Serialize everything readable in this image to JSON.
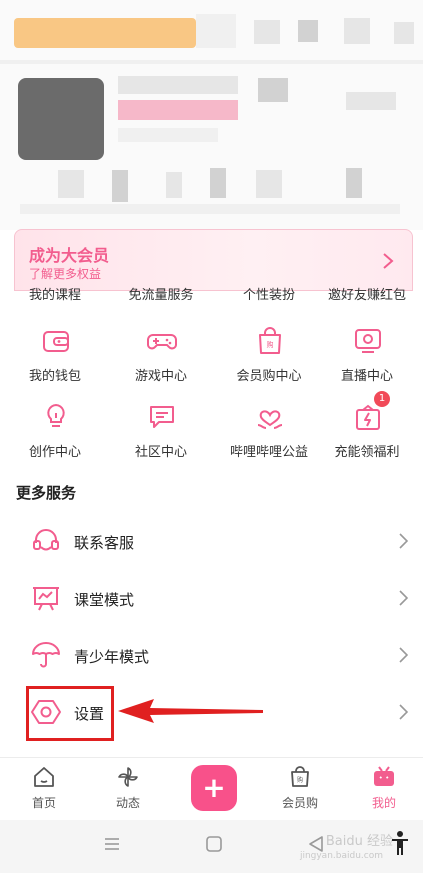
{
  "vip": {
    "title": "成为大会员",
    "subtitle": "了解更多权益"
  },
  "grid_partial_labels": [
    "我的课程",
    "免流量服务",
    "个性装扮",
    "邀好友赚红包"
  ],
  "grid": [
    {
      "label": "我的钱包",
      "icon": "wallet-icon"
    },
    {
      "label": "游戏中心",
      "icon": "gamepad-icon"
    },
    {
      "label": "会员购中心",
      "icon": "shopping-bag-icon"
    },
    {
      "label": "直播中心",
      "icon": "live-tv-icon"
    },
    {
      "label": "创作中心",
      "icon": "lightbulb-icon"
    },
    {
      "label": "社区中心",
      "icon": "chat-icon"
    },
    {
      "label": "哔哩哔哩公益",
      "icon": "heart-hands-icon"
    },
    {
      "label": "充能领福利",
      "icon": "charge-gift-icon",
      "badge": "1"
    }
  ],
  "more_services": {
    "title": "更多服务",
    "items": [
      {
        "label": "联系客服",
        "icon": "headset-icon"
      },
      {
        "label": "课堂模式",
        "icon": "classroom-icon"
      },
      {
        "label": "青少年模式",
        "icon": "umbrella-icon"
      },
      {
        "label": "设置",
        "icon": "settings-hex-icon"
      }
    ]
  },
  "tabbar": {
    "tabs": [
      {
        "label": "首页",
        "icon": "home-icon"
      },
      {
        "label": "动态",
        "icon": "pinwheel-icon"
      },
      {
        "label": "会员购",
        "icon": "shopping-bag-icon"
      },
      {
        "label": "我的",
        "icon": "tv-icon",
        "active": true
      }
    ],
    "plus_label": "+"
  },
  "watermark": {
    "text": "Baidu 经验",
    "sub": "jingyan.baidu.com"
  },
  "colors": {
    "accent": "#f25d8e",
    "highlight": "#e02020",
    "badge": "#f14a58"
  }
}
